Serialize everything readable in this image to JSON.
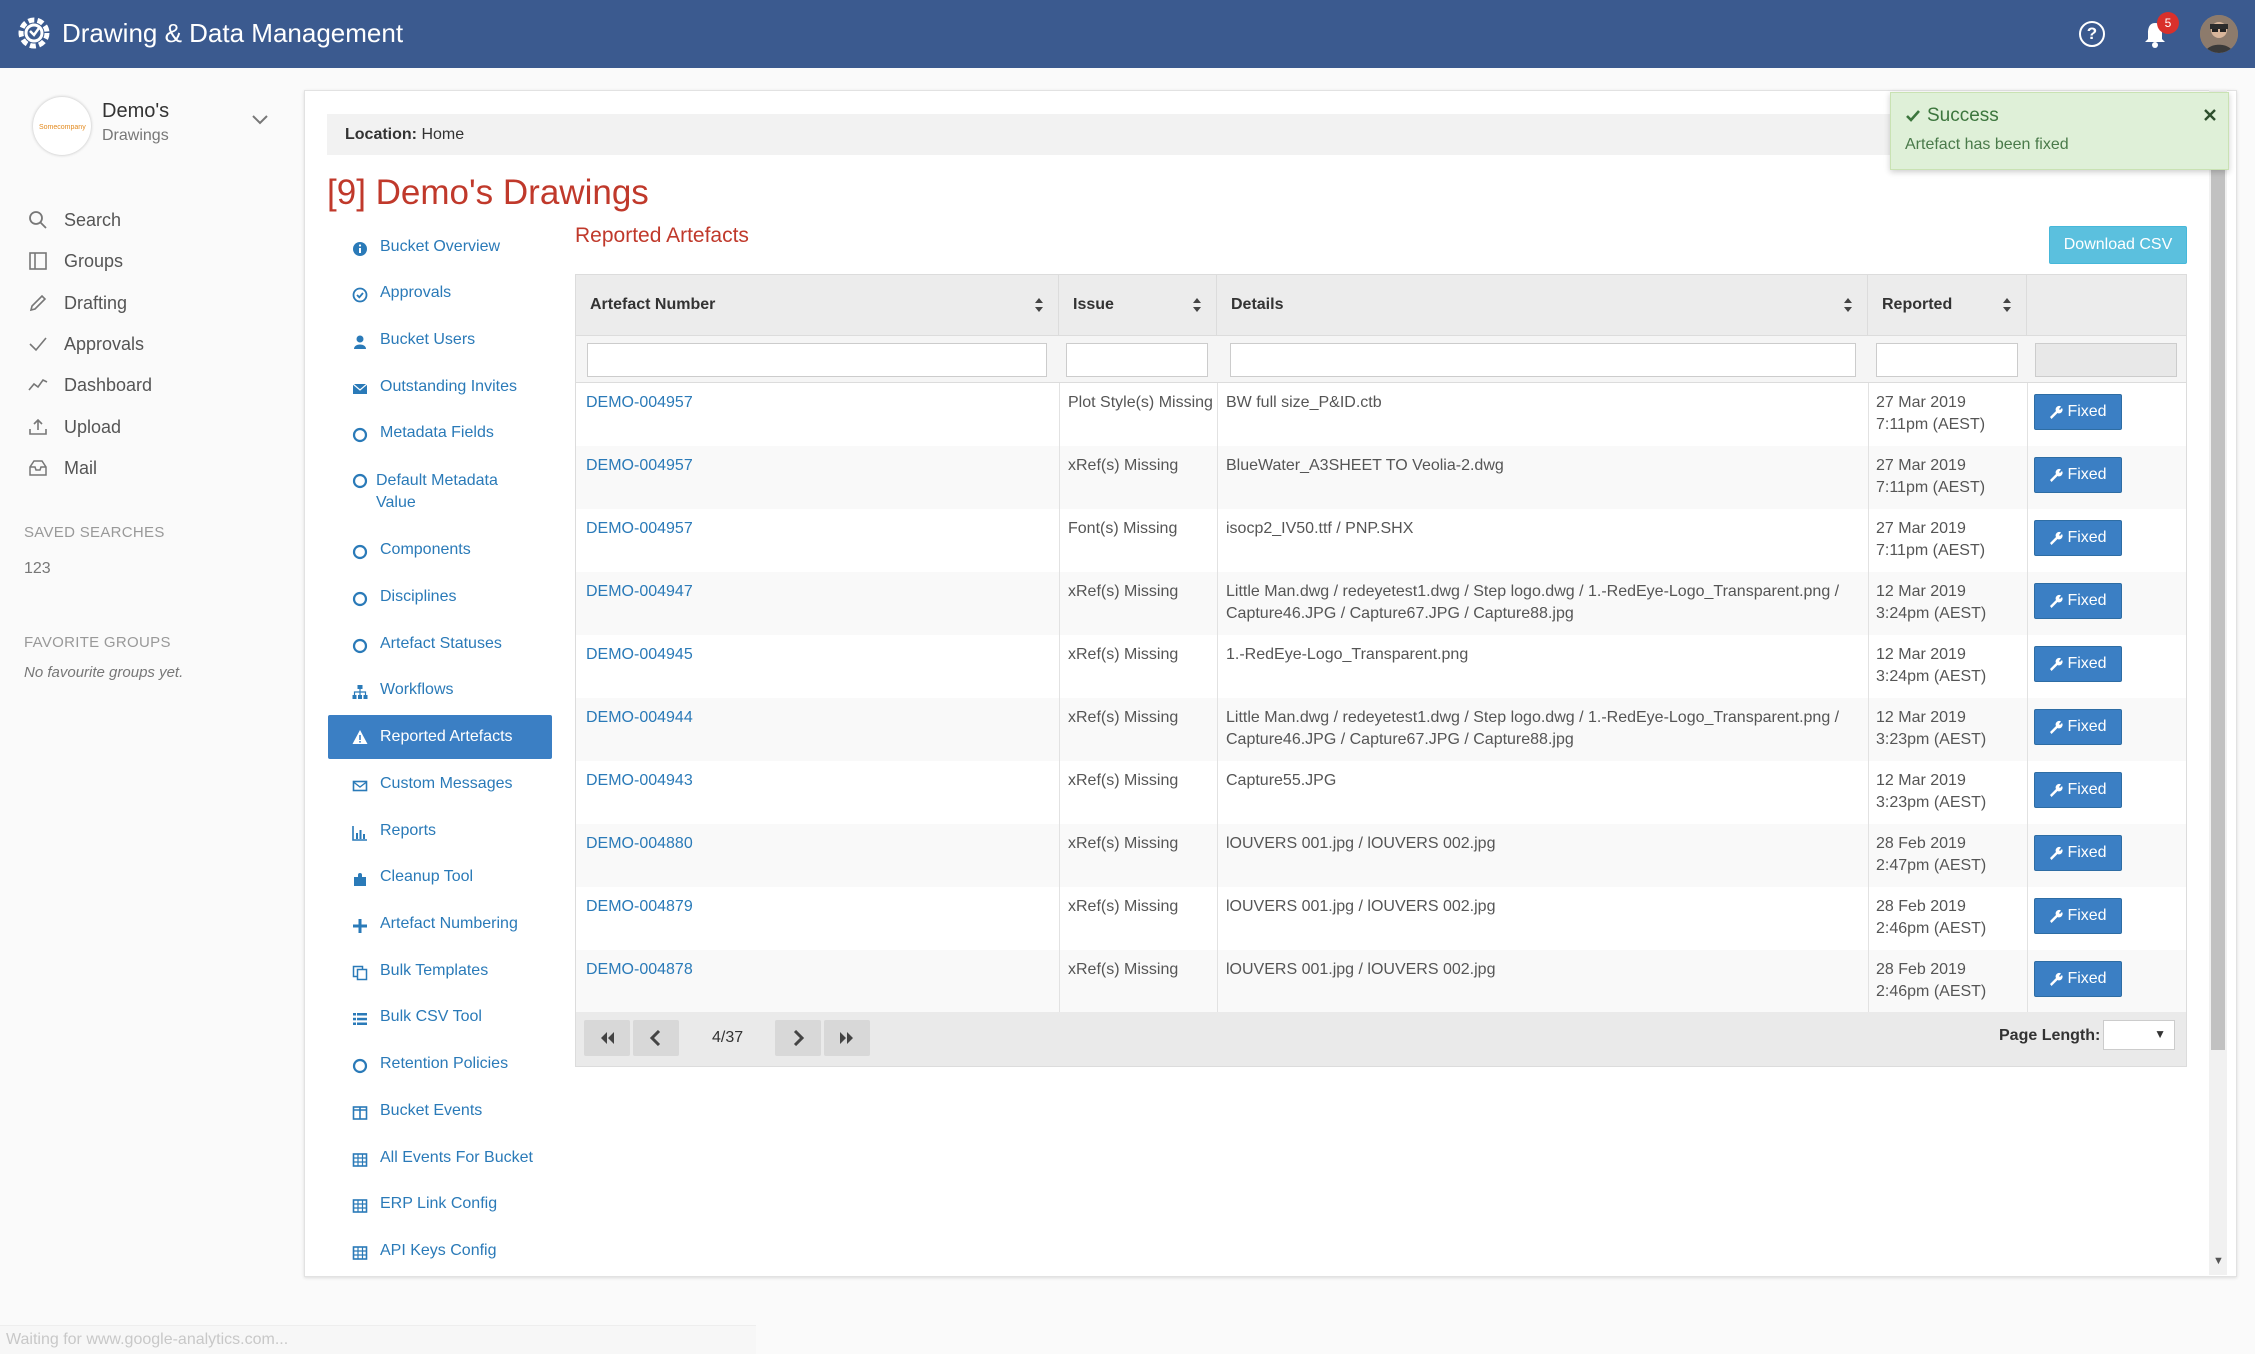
{
  "app": {
    "title": "Drawing & Data Management",
    "notification_count": "5"
  },
  "bucket": {
    "name": "Demo's",
    "subtitle": "Drawings",
    "logo_text": "Somecompany"
  },
  "nav": [
    {
      "label": "Search",
      "icon": "search-icon"
    },
    {
      "label": "Groups",
      "icon": "groups-icon"
    },
    {
      "label": "Drafting",
      "icon": "pencil-icon"
    },
    {
      "label": "Approvals",
      "icon": "check-icon"
    },
    {
      "label": "Dashboard",
      "icon": "chart-line-icon"
    },
    {
      "label": "Upload",
      "icon": "upload-icon"
    },
    {
      "label": "Mail",
      "icon": "mail-icon"
    }
  ],
  "saved_searches": {
    "heading": "SAVED SEARCHES",
    "items": [
      "123"
    ]
  },
  "favorite_groups": {
    "heading": "FAVORITE GROUPS",
    "empty": "No favourite groups yet."
  },
  "breadcrumb": {
    "label": "Location:",
    "value": "Home"
  },
  "page": {
    "title": "[9] Demo's Drawings",
    "section": "Reported Artefacts",
    "download_label": "Download CSV"
  },
  "submenu": [
    {
      "label": "Bucket Overview",
      "icon": "info-icon"
    },
    {
      "label": "Approvals",
      "icon": "check-circle-icon"
    },
    {
      "label": "Bucket Users",
      "icon": "user-icon"
    },
    {
      "label": "Outstanding Invites",
      "icon": "envelope-icon"
    },
    {
      "label": "Metadata Fields",
      "icon": "circle-icon"
    },
    {
      "label": "Default Metadata Value",
      "icon": "circle-icon"
    },
    {
      "label": "Components",
      "icon": "circle-icon"
    },
    {
      "label": "Disciplines",
      "icon": "circle-icon"
    },
    {
      "label": "Artefact Statuses",
      "icon": "circle-icon"
    },
    {
      "label": "Workflows",
      "icon": "sitemap-icon"
    },
    {
      "label": "Reported Artefacts",
      "icon": "warning-icon",
      "active": true
    },
    {
      "label": "Custom Messages",
      "icon": "envelope-open-icon"
    },
    {
      "label": "Reports",
      "icon": "bar-chart-icon"
    },
    {
      "label": "Cleanup Tool",
      "icon": "puzzle-icon"
    },
    {
      "label": "Artefact Numbering",
      "icon": "plus-icon"
    },
    {
      "label": "Bulk Templates",
      "icon": "copy-icon"
    },
    {
      "label": "Bulk CSV Tool",
      "icon": "list-icon"
    },
    {
      "label": "Retention Policies",
      "icon": "circle-icon"
    },
    {
      "label": "Bucket Events",
      "icon": "columns-icon"
    },
    {
      "label": "All Events For Bucket",
      "icon": "table-icon"
    },
    {
      "label": "ERP Link Config",
      "icon": "table-icon"
    },
    {
      "label": "API Keys Config",
      "icon": "table-icon"
    }
  ],
  "table": {
    "columns": [
      "Artefact Number",
      "Issue",
      "Details",
      "Reported"
    ],
    "fixed_label": "Fixed",
    "rows": [
      {
        "number": "DEMO-004957",
        "issue": "Plot Style(s) Missing",
        "details": "BW full size_P&ID.ctb",
        "date": "27 Mar 2019",
        "time": "7:11pm (AEST)"
      },
      {
        "number": "DEMO-004957",
        "issue": "xRef(s) Missing",
        "details": "BlueWater_A3SHEET TO Veolia-2.dwg",
        "date": "27 Mar 2019",
        "time": "7:11pm (AEST)"
      },
      {
        "number": "DEMO-004957",
        "issue": "Font(s) Missing",
        "details": "isocp2_IV50.ttf / PNP.SHX",
        "date": "27 Mar 2019",
        "time": "7:11pm (AEST)"
      },
      {
        "number": "DEMO-004947",
        "issue": "xRef(s) Missing",
        "details": "Little Man.dwg / redeyetest1.dwg / Step logo.dwg / 1.-RedEye-Logo_Transparent.png / Capture46.JPG / Capture67.JPG / Capture88.jpg",
        "date": "12 Mar 2019",
        "time": "3:24pm (AEST)"
      },
      {
        "number": "DEMO-004945",
        "issue": "xRef(s) Missing",
        "details": "1.-RedEye-Logo_Transparent.png",
        "date": "12 Mar 2019",
        "time": "3:24pm (AEST)"
      },
      {
        "number": "DEMO-004944",
        "issue": "xRef(s) Missing",
        "details": "Little Man.dwg / redeyetest1.dwg / Step logo.dwg / 1.-RedEye-Logo_Transparent.png / Capture46.JPG / Capture67.JPG / Capture88.jpg",
        "date": "12 Mar 2019",
        "time": "3:23pm (AEST)"
      },
      {
        "number": "DEMO-004943",
        "issue": "xRef(s) Missing",
        "details": "Capture55.JPG",
        "date": "12 Mar 2019",
        "time": "3:23pm (AEST)"
      },
      {
        "number": "DEMO-004880",
        "issue": "xRef(s) Missing",
        "details": "lOUVERS 001.jpg / lOUVERS 002.jpg",
        "date": "28 Feb 2019",
        "time": "2:47pm (AEST)"
      },
      {
        "number": "DEMO-004879",
        "issue": "xRef(s) Missing",
        "details": "lOUVERS 001.jpg / lOUVERS 002.jpg",
        "date": "28 Feb 2019",
        "time": "2:46pm (AEST)"
      },
      {
        "number": "DEMO-004878",
        "issue": "xRef(s) Missing",
        "details": "lOUVERS 001.jpg / lOUVERS 002.jpg",
        "date": "28 Feb 2019",
        "time": "2:46pm (AEST)"
      }
    ]
  },
  "pager": {
    "info": "4/37",
    "page_length_label": "Page Length:"
  },
  "toast": {
    "title": "Success",
    "message": "Artefact has been fixed"
  },
  "status_bar": "Waiting for www.google-analytics.com...",
  "colors": {
    "topbar": "#3b5a8f",
    "accent": "#3b7fc4",
    "title_red": "#c0392b",
    "success_bg": "#dff0d8"
  }
}
